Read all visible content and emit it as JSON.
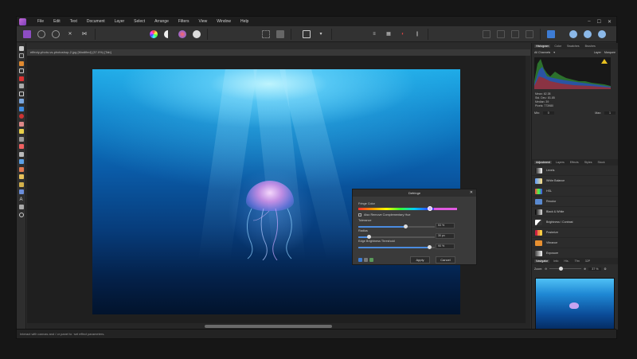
{
  "app": {
    "menu": [
      "File",
      "Edit",
      "Text",
      "Document",
      "Layer",
      "Select",
      "Arrange",
      "Filters",
      "View",
      "Window",
      "Help"
    ],
    "window_controls": [
      "–",
      "☐",
      "✕"
    ]
  },
  "document": {
    "tab_title": "effecty-photo-vs-photoshop-2.jpg [Modified] (37.0%) [Tab]"
  },
  "dialog": {
    "title": "Defringe",
    "fringe_color_label": "Fringe Color",
    "also_remove_label": "Also Remove Complementary Hue",
    "tolerance_label": "Tolerance",
    "tolerance_value": "53 %",
    "tolerance_level": 0.62,
    "radius_label": "Radius",
    "radius_value": "30 px",
    "radius_level": 0.14,
    "edge_label": "Edge Brightness Threshold",
    "edge_value": "90 %",
    "edge_level": 0.93,
    "apply_label": "Apply",
    "cancel_label": "Cancel"
  },
  "right_panel": {
    "top_tabs": [
      "Histogram",
      "Color",
      "Swatches",
      "Brushes"
    ],
    "channel_select": "All Channels",
    "layer_label": "Layer",
    "marquee_label": "Marquee",
    "stats": [
      "Mean: 62.38",
      "Std. Dev.: 81.85",
      "Median: 39",
      "Pixels: 773980"
    ],
    "min_label": "Min:",
    "min_value": "0",
    "max_label": "Max:",
    "max_value": "1",
    "adjust_tabs": [
      "Adjustment",
      "Layers",
      "Effects",
      "Styles",
      "Stock"
    ],
    "adjustments": [
      "Levels",
      "White Balance",
      "HSL",
      "Recolor",
      "Black & White",
      "Brightness / Contrast",
      "Posterize",
      "Vibrance",
      "Exposure"
    ],
    "nav_tabs": [
      "Navigator",
      "Info",
      "His.",
      "Tfm",
      "32P"
    ],
    "zoom_label": "Zoom:",
    "zoom_value": "37 %"
  },
  "statusbar": {
    "text": "Interact with canvas and / or panel to ·set effect parameters."
  },
  "colors": {
    "accent": "#4a8be0",
    "app_icon": "#b05ad0"
  }
}
